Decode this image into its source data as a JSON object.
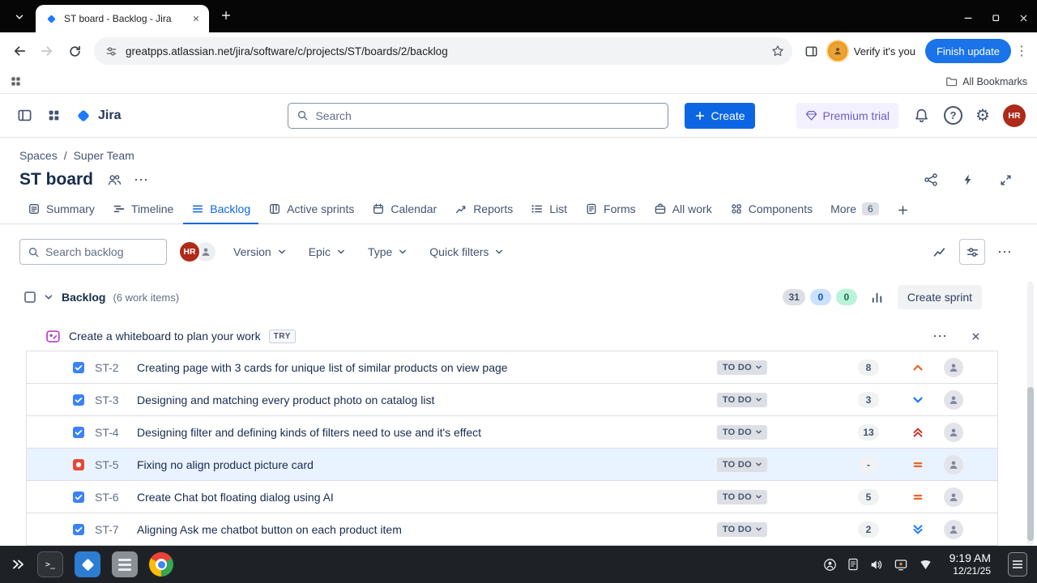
{
  "browser": {
    "tab_title": "ST board - Backlog - Jira",
    "url": "greatpps.atlassian.net/jira/software/c/projects/ST/boards/2/backlog",
    "verify_label": "Verify it's you",
    "update_label": "Finish update",
    "bookmarks_label": "All Bookmarks"
  },
  "nav": {
    "product": "Jira",
    "search_placeholder": "Search",
    "create_label": "Create",
    "premium_label": "Premium trial",
    "avatar_initials": "HR"
  },
  "breadcrumb": {
    "root": "Spaces",
    "separator": "/",
    "current": "Super Team"
  },
  "board": {
    "title": "ST board"
  },
  "tabs": [
    {
      "id": "summary",
      "label": "Summary"
    },
    {
      "id": "timeline",
      "label": "Timeline"
    },
    {
      "id": "backlog",
      "label": "Backlog",
      "active": true
    },
    {
      "id": "active-sprints",
      "label": "Active sprints"
    },
    {
      "id": "calendar",
      "label": "Calendar"
    },
    {
      "id": "reports",
      "label": "Reports"
    },
    {
      "id": "list",
      "label": "List"
    },
    {
      "id": "forms",
      "label": "Forms"
    },
    {
      "id": "all-work",
      "label": "All work"
    },
    {
      "id": "components",
      "label": "Components"
    },
    {
      "id": "more",
      "label": "More",
      "badge": "6"
    }
  ],
  "filters": {
    "search_placeholder": "Search backlog",
    "avatar_initials": "HR",
    "dropdowns": [
      {
        "label": "Version"
      },
      {
        "label": "Epic"
      },
      {
        "label": "Type"
      },
      {
        "label": "Quick filters"
      }
    ]
  },
  "backlog": {
    "title": "Backlog",
    "count_label": "(6 work items)",
    "summary_badges": [
      {
        "value": "31",
        "color": "gray"
      },
      {
        "value": "0",
        "color": "blue"
      },
      {
        "value": "0",
        "color": "green"
      }
    ],
    "create_sprint_label": "Create sprint",
    "banner": {
      "message": "Create a whiteboard to plan your work",
      "badge": "TRY"
    },
    "items": [
      {
        "key": "ST-2",
        "title": "Creating page with 3 cards for unique list of similar products on view page",
        "type": "task",
        "status": "TO DO",
        "estimate": "8",
        "priority": "high"
      },
      {
        "key": "ST-3",
        "title": "Designing and matching every product photo on catalog list",
        "type": "task",
        "status": "TO DO",
        "estimate": "3",
        "priority": "low"
      },
      {
        "key": "ST-4",
        "title": "Designing filter and defining kinds of filters need to use and it's effect",
        "type": "task",
        "status": "TO DO",
        "estimate": "13",
        "priority": "highest"
      },
      {
        "key": "ST-5",
        "title": "Fixing no align product picture card",
        "type": "bug",
        "status": "TO DO",
        "estimate": "-",
        "priority": "medium",
        "selected": true
      },
      {
        "key": "ST-6",
        "title": "Create Chat bot floating dialog using AI",
        "type": "task",
        "status": "TO DO",
        "estimate": "5",
        "priority": "medium"
      },
      {
        "key": "ST-7",
        "title": "Aligning Ask me chatbot button on each product item",
        "type": "task",
        "status": "TO DO",
        "estimate": "2",
        "priority": "lowest"
      }
    ]
  },
  "taskbar": {
    "time": "9:19 AM",
    "date": "12/21/25"
  },
  "colors": {
    "accent": "#0C66E4",
    "task": "#3B82F6",
    "bug": "#E34935",
    "priority_high": "#E9662B",
    "priority_highest": "#C9372C",
    "priority_medium": "#E9662B",
    "priority_low": "#1D7AFC",
    "priority_lowest": "#1D7AFC",
    "status_bg": "#DCDFE4",
    "status_text": "#44546F"
  }
}
